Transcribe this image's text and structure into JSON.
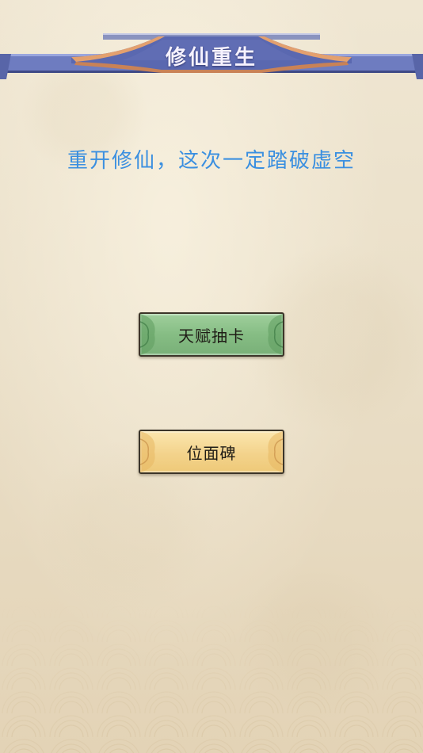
{
  "header": {
    "title": "修仙重生"
  },
  "subtitle": "重开修仙，这次一定踏破虚空",
  "buttons": {
    "talent_draw": "天赋抽卡",
    "plane_monument": "位面碑"
  },
  "colors": {
    "header_blue": "#5b6ab0",
    "header_trim": "#d89a6a",
    "subtitle_blue": "#3a8fe0",
    "green_button": "#86bd84",
    "gold_button": "#f3d38c",
    "paper": "#ece2cc"
  }
}
